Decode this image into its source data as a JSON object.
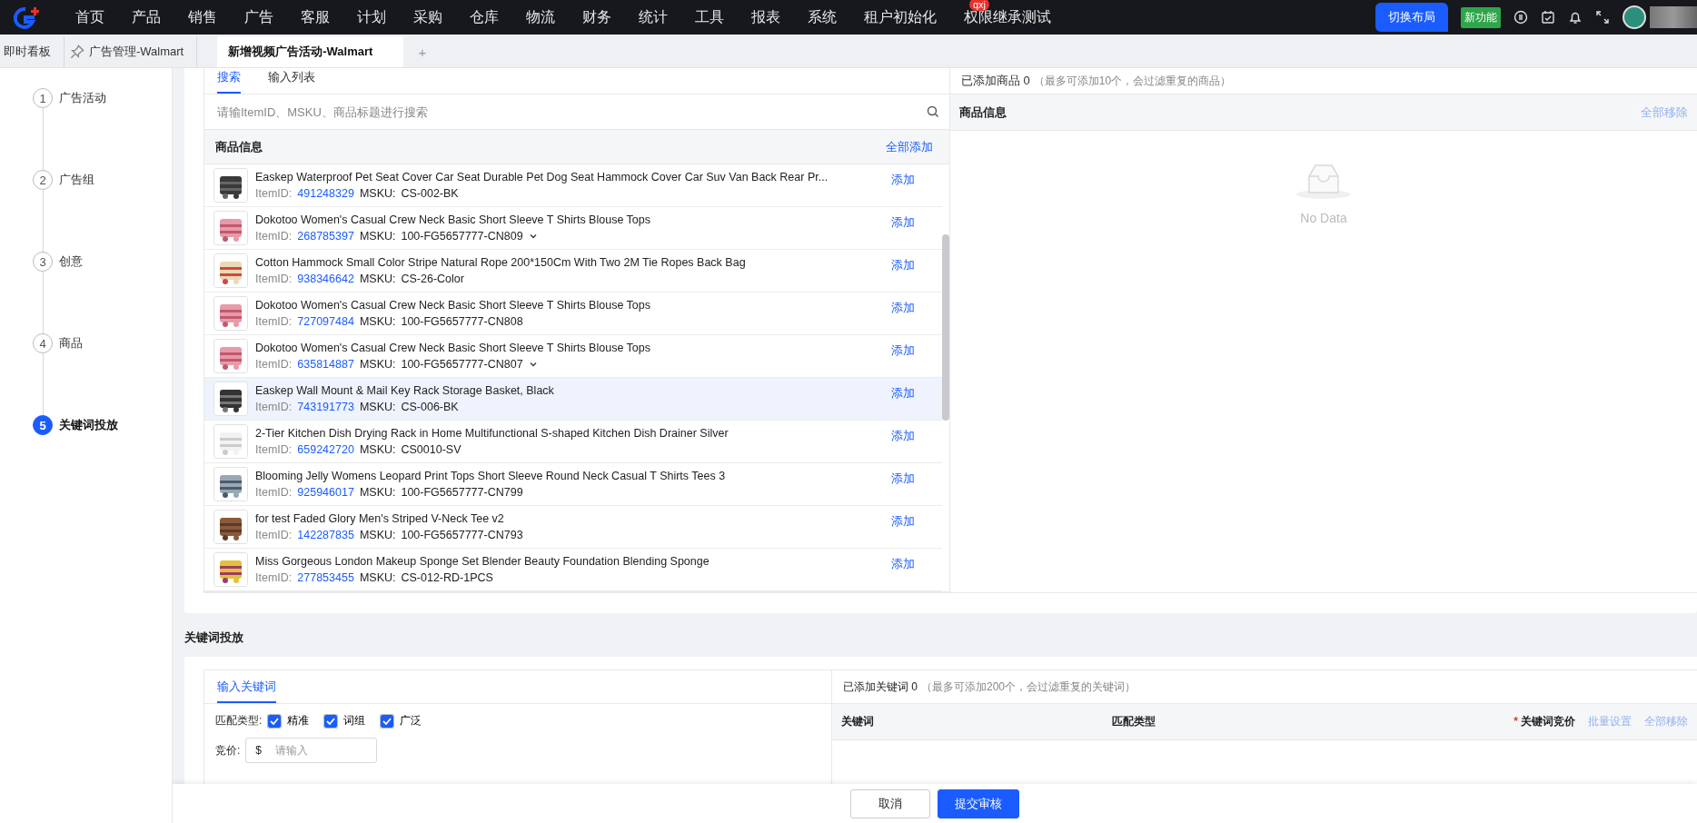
{
  "nav": {
    "items": [
      {
        "label": "首页",
        "selected": false
      },
      {
        "label": "产品",
        "selected": false
      },
      {
        "label": "销售",
        "selected": false
      },
      {
        "label": "广告",
        "selected": false
      },
      {
        "label": "客服",
        "selected": false
      },
      {
        "label": "计划",
        "selected": false
      },
      {
        "label": "采购",
        "selected": false
      },
      {
        "label": "仓库",
        "selected": false
      },
      {
        "label": "物流",
        "selected": false
      },
      {
        "label": "财务",
        "selected": false
      },
      {
        "label": "统计",
        "selected": false
      },
      {
        "label": "工具",
        "selected": false
      },
      {
        "label": "报表",
        "selected": false
      },
      {
        "label": "系统",
        "selected": false
      },
      {
        "label": "租户初始化",
        "selected": false
      },
      {
        "label": "权限继承测试",
        "selected": false,
        "badge": "qxj"
      }
    ],
    "layout_button": "切换布局",
    "new_feature": "新功能"
  },
  "tabs": [
    {
      "label": "即时看板",
      "selected": false,
      "pinned": false
    },
    {
      "label": "广告管理-Walmart",
      "selected": false,
      "pinned": true
    },
    {
      "label": "新增视频广告活动-Walmart",
      "selected": true,
      "pinned": false
    }
  ],
  "add_tab": "+",
  "steps": [
    {
      "number": "1",
      "label": "广告活动",
      "selected": false
    },
    {
      "number": "2",
      "label": "广告组",
      "selected": false
    },
    {
      "number": "3",
      "label": "创意",
      "selected": false
    },
    {
      "number": "4",
      "label": "商品",
      "selected": false
    },
    {
      "number": "5",
      "label": "关键词投放",
      "selected": true
    }
  ],
  "products": {
    "tabs": [
      {
        "label": "搜索",
        "selected": true
      },
      {
        "label": "输入列表",
        "selected": false
      }
    ],
    "search": {
      "placeholder": "请输ItemID、MSKU、商品标题进行搜索"
    },
    "header": "商品信息",
    "add_all": "全部添加",
    "rows": [
      {
        "title": "Easkep Waterproof Pet Seat Cover Car Seat Durable Pet Dog Seat Hammock Cover Car Suv Van Back Rear Pr...",
        "item_label": "ItemID:",
        "item_id": "491248329",
        "msku_label": "MSKU:",
        "msku": "CS-002-BK",
        "expandable": false,
        "highlighted": false,
        "action": "添加"
      },
      {
        "title": "Dokotoo Women's Casual Crew Neck Basic Short Sleeve T Shirts Blouse Tops",
        "item_label": "ItemID:",
        "item_id": "268785397",
        "msku_label": "MSKU:",
        "msku": "100-FG5657777-CN809",
        "expandable": true,
        "highlighted": false,
        "action": "添加"
      },
      {
        "title": "Cotton Hammock Small Color Stripe Natural Rope 200*150Cm With Two 2M Tie Ropes Back Bag",
        "item_label": "ItemID:",
        "item_id": "938346642",
        "msku_label": "MSKU:",
        "msku": "CS-26-Color",
        "expandable": false,
        "highlighted": false,
        "action": "添加"
      },
      {
        "title": "Dokotoo Women's Casual Crew Neck Basic Short Sleeve T Shirts Blouse Tops",
        "item_label": "ItemID:",
        "item_id": "727097484",
        "msku_label": "MSKU:",
        "msku": "100-FG5657777-CN808",
        "expandable": false,
        "highlighted": false,
        "action": "添加"
      },
      {
        "title": "Dokotoo Women's Casual Crew Neck Basic Short Sleeve T Shirts Blouse Tops",
        "item_label": "ItemID:",
        "item_id": "635814887",
        "msku_label": "MSKU:",
        "msku": "100-FG5657777-CN807",
        "expandable": true,
        "highlighted": false,
        "action": "添加"
      },
      {
        "title": "Easkep Wall Mount & Mail Key Rack Storage Basket, Black",
        "item_label": "ItemID:",
        "item_id": "743191773",
        "msku_label": "MSKU:",
        "msku": "CS-006-BK",
        "expandable": false,
        "highlighted": true,
        "action": "添加"
      },
      {
        "title": "2-Tier Kitchen Dish Drying Rack in Home Multifunctional S-shaped Kitchen Dish Drainer Silver",
        "item_label": "ItemID:",
        "item_id": "659242720",
        "msku_label": "MSKU:",
        "msku": "CS0010-SV",
        "expandable": false,
        "highlighted": false,
        "action": "添加"
      },
      {
        "title": "Blooming Jelly Womens Leopard Print Tops Short Sleeve Round Neck Casual T Shirts Tees 3",
        "item_label": "ItemID:",
        "item_id": "925946017",
        "msku_label": "MSKU:",
        "msku": "100-FG5657777-CN799",
        "expandable": false,
        "highlighted": false,
        "action": "添加"
      },
      {
        "title": "for test Faded Glory Men's Striped V-Neck Tee v2",
        "item_label": "ItemID:",
        "item_id": "142287835",
        "msku_label": "MSKU:",
        "msku": "100-FG5657777-CN793",
        "expandable": false,
        "highlighted": false,
        "action": "添加"
      },
      {
        "title": "Miss Gorgeous London Makeup Sponge Set Blender Beauty Foundation Blending Sponge",
        "item_label": "ItemID:",
        "item_id": "277853455",
        "msku_label": "MSKU:",
        "msku": "CS-012-RD-1PCS",
        "expandable": false,
        "highlighted": false,
        "action": "添加"
      }
    ]
  },
  "added": {
    "title": "已添加商品",
    "count": "0",
    "note": "（最多可添加10个，会过滤重复的商品）",
    "header": "商品信息",
    "remove_all": {
      "label": "全部移除",
      "disabled": true
    },
    "empty": "No Data"
  },
  "keywords": {
    "title": "关键词投放",
    "tabs": [
      {
        "label": "输入关键词",
        "selected": true
      }
    ],
    "match_label": "匹配类型:",
    "match_types": [
      {
        "label": "精准",
        "checked": true
      },
      {
        "label": "词组",
        "checked": true
      },
      {
        "label": "广泛",
        "checked": true
      }
    ],
    "bid_label": "竞价:",
    "bid_prefix": "$",
    "bid_placeholder": "请输入",
    "added_title": "已添加关键词",
    "added_count": "0",
    "added_note": "（最多可添加200个，会过滤重复的关键词）",
    "columns": [
      {
        "label": "关键词"
      },
      {
        "label": "匹配类型"
      },
      {
        "label": "关键词竞价",
        "mark": "*"
      }
    ],
    "batch_set": {
      "label": "批量设置",
      "disabled": true
    },
    "remove_all": {
      "label": "全部移除",
      "disabled": true
    }
  },
  "footer": {
    "buttons": [
      {
        "label": "取消",
        "kind": "default"
      },
      {
        "label": "提交审核",
        "kind": "primary"
      }
    ]
  }
}
